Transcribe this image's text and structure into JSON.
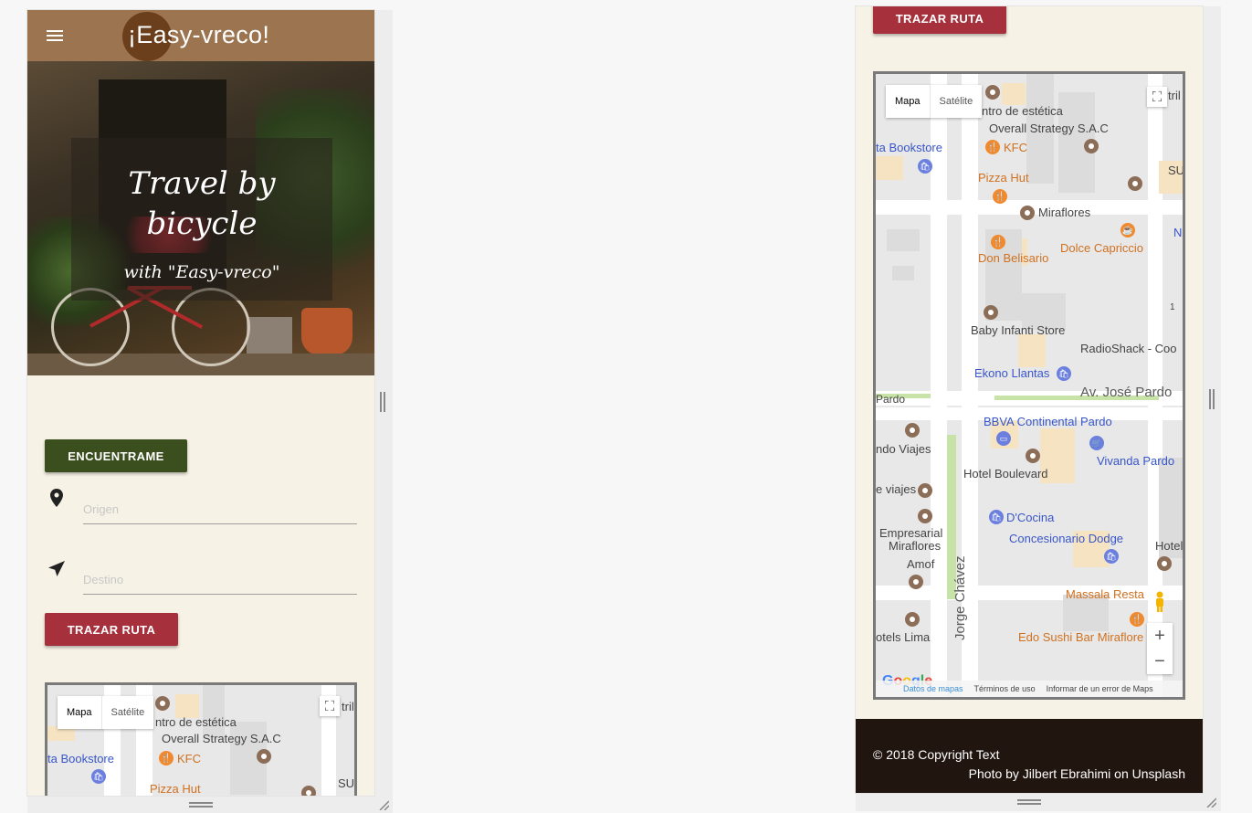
{
  "app": {
    "title": "¡Easy-vreco!"
  },
  "hero": {
    "line1": "Travel by",
    "line2": "bicycle",
    "line3": "with \"Easy-vreco\""
  },
  "actions": {
    "find_me": "ENCUENTRAME",
    "trace_route": "TRAZAR RUTA"
  },
  "form": {
    "origin_placeholder": "Origen",
    "destination_placeholder": "Destino"
  },
  "map": {
    "type_map": "Mapa",
    "type_satellite": "Satélite",
    "labels": {
      "estetica": "ntro de estética",
      "overall": "Overall Strategy S.A.C",
      "bookstore": "ta Bookstore",
      "kfc": "KFC",
      "pizza": "Pizza Hut",
      "su": "SU",
      "tri": "tril",
      "miraflores": "Miraflores",
      "dolce": "Dolce Capriccio",
      "belisario": "Don Belisario",
      "baby": "Baby Infanti Store",
      "radioshack": "RadioShack - Coo",
      "ekono": "Ekono Llantas",
      "pardo_left": "Pardo",
      "pardo": "Av. José Pardo",
      "bbva": "BBVA Continental Pardo",
      "viajes1": "ndo Viajes",
      "hotel_boulevard": "Hotel Boulevard",
      "vivanda": "Vivanda Pardo",
      "viajes2": "e viajes",
      "dcocina": "D'Cocina",
      "empresarial": "Empresarial",
      "empresarial2": "Miraflores",
      "dodge": "Concesionario Dodge",
      "hotel_m": "Hotel M",
      "amof": "Amof",
      "chavez": "Jorge Chávez",
      "massala": "Massala Resta",
      "hotels_lima": "otels Lima",
      "edo": "Edo Sushi Bar Miraflore",
      "n": "N",
      "one": "1"
    },
    "zoom_in": "+",
    "zoom_out": "−",
    "google": "Google",
    "footer_data": "Datos de mapas",
    "footer_terms": "Términos de uso",
    "footer_report": "Informar de un error de Maps"
  },
  "footer": {
    "copyright": "© 2018 Copyright Text",
    "credit": "Photo by Jilbert Ebrahimi on Unsplash"
  },
  "colors": {
    "appbar": "#9c7550",
    "find_button": "#3b4f1e",
    "route_button": "#a6303b",
    "page_bg": "#f7f2e6",
    "footer_bg": "#211510"
  }
}
